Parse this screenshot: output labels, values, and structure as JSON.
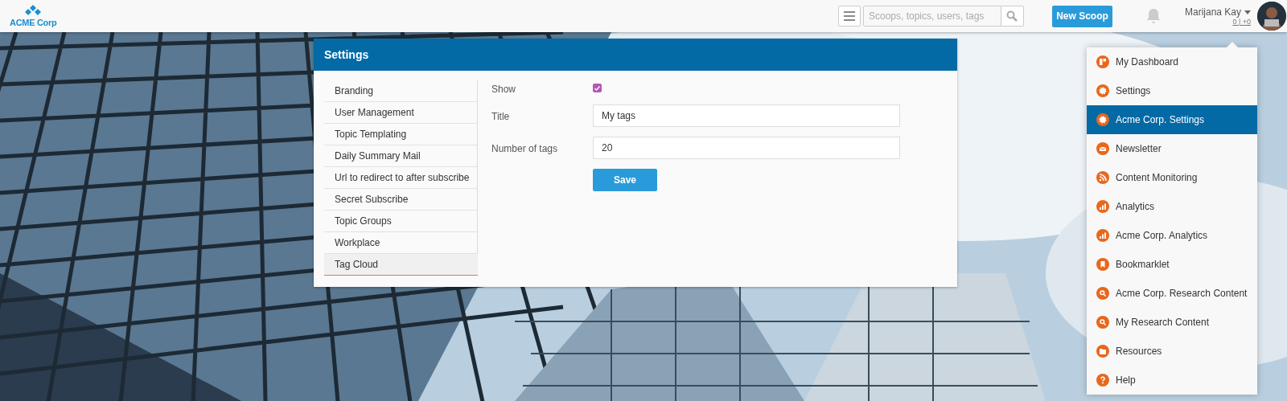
{
  "header": {
    "logo": "ACME Corp",
    "search": {
      "placeholder": "Scoops, topics, users, tags"
    },
    "new_button": "New Scoop",
    "user": {
      "name": "Marijana Kay",
      "stats": "0 | +0"
    }
  },
  "settings": {
    "title": "Settings",
    "sidebar": [
      {
        "label": "Branding",
        "selected": false
      },
      {
        "label": "User Management",
        "selected": false
      },
      {
        "label": "Topic Templating",
        "selected": false
      },
      {
        "label": "Daily Summary Mail",
        "selected": false
      },
      {
        "label": "Url to redirect to after subscribe",
        "selected": false
      },
      {
        "label": "Secret Subscribe",
        "selected": false
      },
      {
        "label": "Topic Groups",
        "selected": false
      },
      {
        "label": "Workplace",
        "selected": false
      },
      {
        "label": "Tag Cloud",
        "selected": true
      }
    ],
    "form": {
      "show": {
        "label": "Show",
        "checked": true
      },
      "title": {
        "label": "Title",
        "value": "My tags"
      },
      "number_of_tags": {
        "label": "Number of tags",
        "value": "20"
      },
      "save": "Save"
    }
  },
  "user_menu": [
    {
      "label": "My Dashboard",
      "selected": false
    },
    {
      "label": "Settings",
      "selected": false
    },
    {
      "label": "Acme Corp. Settings",
      "selected": true
    },
    {
      "label": "Newsletter",
      "selected": false
    },
    {
      "label": "Content Monitoring",
      "selected": false
    },
    {
      "label": "Analytics",
      "selected": false
    },
    {
      "label": "Acme Corp. Analytics",
      "selected": false
    },
    {
      "label": "Bookmarklet",
      "selected": false
    },
    {
      "label": "Acme Corp. Research Content",
      "selected": false
    },
    {
      "label": "My Research Content",
      "selected": false
    },
    {
      "label": "Resources",
      "selected": false
    },
    {
      "label": "Help",
      "selected": false
    }
  ]
}
